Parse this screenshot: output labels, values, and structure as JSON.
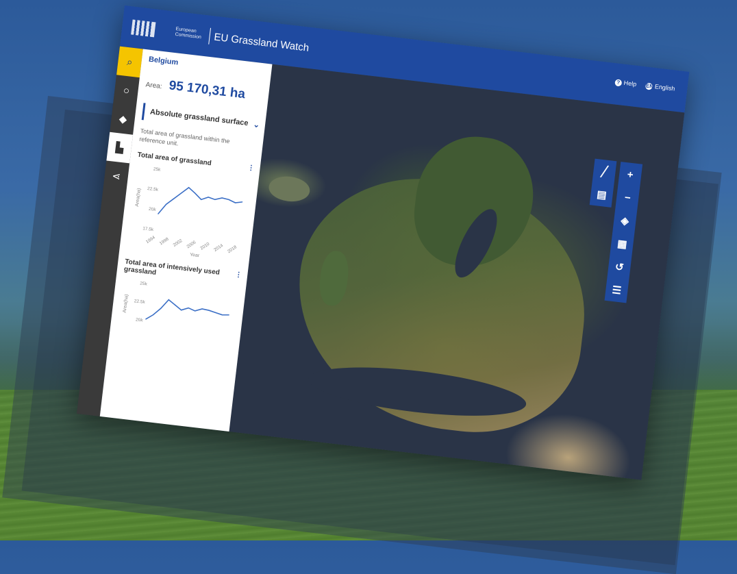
{
  "header": {
    "ec_label": "European Commission",
    "title": "EU Grassland Watch",
    "help_label": "Help",
    "language_label": "English"
  },
  "sidebar": {
    "country": "Belgium",
    "area_label": "Area:",
    "area_value": "95 170,31 ha",
    "indicator": "Absolute grassland surface",
    "indicator_description": "Total area of grassland within the reference unit.",
    "cards": [
      {
        "title": "Total area of grassland",
        "y_axis_label": "Area(ha)",
        "x_axis_label": "Year"
      },
      {
        "title": "Total area of intensively used grassland",
        "y_axis_label": "Area(ha)"
      }
    ]
  },
  "chart_data": [
    {
      "type": "line",
      "title": "Total area of grassland",
      "xlabel": "Year",
      "ylabel": "Area(ha)",
      "x": [
        1994,
        1996,
        1998,
        2000,
        2002,
        2004,
        2006,
        2008,
        2010,
        2012,
        2014,
        2016,
        2018
      ],
      "values": [
        19500,
        20800,
        21600,
        22400,
        23200,
        22600,
        21900,
        22300,
        22100,
        22400,
        22300,
        22000,
        22200
      ],
      "y_ticks": [
        "25k",
        "22.5k",
        "20k",
        "17.5k"
      ],
      "x_ticks": [
        "1994",
        "1998",
        "2002",
        "2006",
        "2010",
        "2014",
        "2018"
      ],
      "ylim": [
        17500,
        25000
      ],
      "color": "#3b6fc6"
    },
    {
      "type": "line",
      "title": "Total area of intensively used grassland",
      "ylabel": "Area(ha)",
      "x": [
        1994,
        1996,
        1998,
        2000,
        2002,
        2004,
        2006,
        2008,
        2010,
        2012,
        2014,
        2016,
        2018
      ],
      "values": [
        20200,
        20900,
        21900,
        23200,
        22600,
        22000,
        22400,
        22100,
        22500,
        22400,
        22200,
        22000,
        22100
      ],
      "y_ticks": [
        "25k",
        "22.5k",
        "20k"
      ],
      "ylim": [
        19000,
        25000
      ],
      "color": "#3b6fc6"
    }
  ],
  "icons": {
    "rail": [
      "search-icon",
      "circle-icon",
      "layers-icon",
      "chart-icon",
      "share-icon"
    ],
    "toolbar": [
      "plus-icon",
      "minus-icon",
      "locate-icon",
      "grid-icon",
      "history-icon",
      "list-icon"
    ],
    "toolbar2": [
      "ruler-icon",
      "print-icon"
    ]
  },
  "colors": {
    "brand_blue": "#1f4aa0",
    "active_yellow": "#f5c400",
    "rail_dark": "#3a3a3a"
  }
}
